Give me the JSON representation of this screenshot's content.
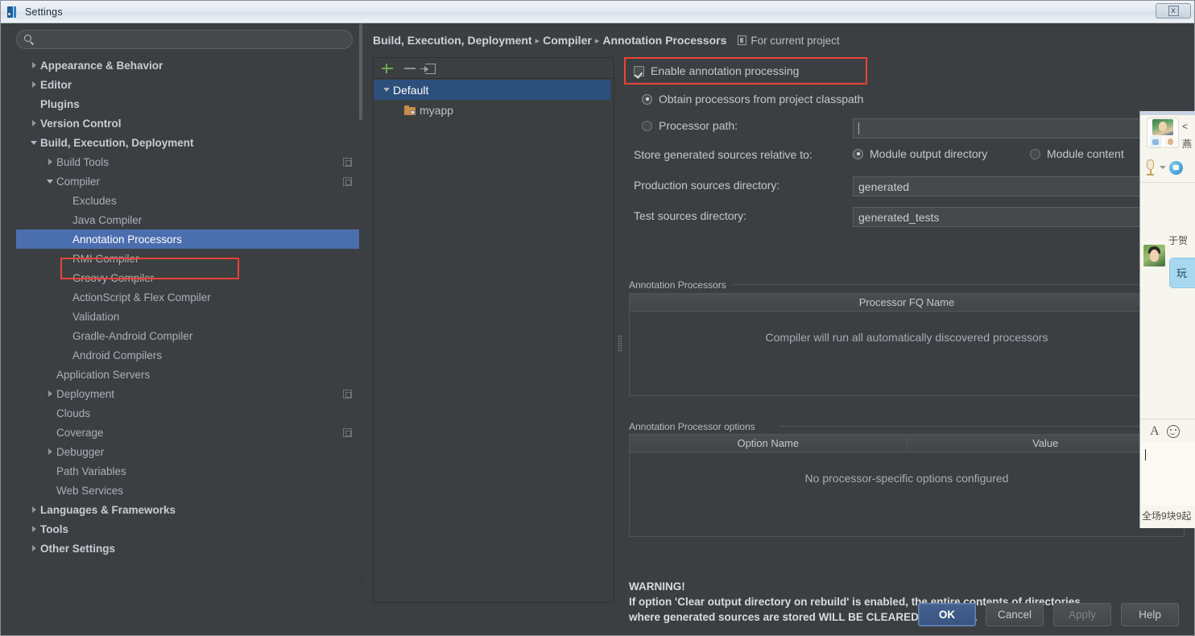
{
  "window": {
    "title": "Settings",
    "app_icon": "intellij-idea-icon",
    "close_label": "x"
  },
  "sidebar": {
    "search": {
      "value": "",
      "placeholder": ""
    },
    "items": [
      {
        "label": "Appearance & Behavior",
        "indent": 0,
        "twisty": "right",
        "bold": true,
        "badge": false,
        "selected": false
      },
      {
        "label": "Editor",
        "indent": 0,
        "twisty": "right",
        "bold": true,
        "badge": false,
        "selected": false
      },
      {
        "label": "Plugins",
        "indent": 0,
        "twisty": "none",
        "bold": true,
        "badge": false,
        "selected": false
      },
      {
        "label": "Version Control",
        "indent": 0,
        "twisty": "right",
        "bold": true,
        "badge": false,
        "selected": false
      },
      {
        "label": "Build, Execution, Deployment",
        "indent": 0,
        "twisty": "down",
        "bold": true,
        "badge": false,
        "selected": false
      },
      {
        "label": "Build Tools",
        "indent": 1,
        "twisty": "right",
        "bold": false,
        "badge": true,
        "selected": false
      },
      {
        "label": "Compiler",
        "indent": 1,
        "twisty": "down",
        "bold": false,
        "badge": true,
        "selected": false
      },
      {
        "label": "Excludes",
        "indent": 2,
        "twisty": "none",
        "bold": false,
        "badge": false,
        "selected": false
      },
      {
        "label": "Java Compiler",
        "indent": 2,
        "twisty": "none",
        "bold": false,
        "badge": false,
        "selected": false
      },
      {
        "label": "Annotation Processors",
        "indent": 2,
        "twisty": "none",
        "bold": false,
        "badge": false,
        "selected": true
      },
      {
        "label": "RMI Compiler",
        "indent": 2,
        "twisty": "none",
        "bold": false,
        "badge": false,
        "selected": false
      },
      {
        "label": "Groovy Compiler",
        "indent": 2,
        "twisty": "none",
        "bold": false,
        "badge": false,
        "selected": false
      },
      {
        "label": "ActionScript & Flex Compiler",
        "indent": 2,
        "twisty": "none",
        "bold": false,
        "badge": false,
        "selected": false
      },
      {
        "label": "Validation",
        "indent": 2,
        "twisty": "none",
        "bold": false,
        "badge": false,
        "selected": false
      },
      {
        "label": "Gradle-Android Compiler",
        "indent": 2,
        "twisty": "none",
        "bold": false,
        "badge": false,
        "selected": false
      },
      {
        "label": "Android Compilers",
        "indent": 2,
        "twisty": "none",
        "bold": false,
        "badge": false,
        "selected": false
      },
      {
        "label": "Application Servers",
        "indent": 1,
        "twisty": "none",
        "bold": false,
        "badge": false,
        "selected": false
      },
      {
        "label": "Deployment",
        "indent": 1,
        "twisty": "right",
        "bold": false,
        "badge": true,
        "selected": false
      },
      {
        "label": "Clouds",
        "indent": 1,
        "twisty": "none",
        "bold": false,
        "badge": false,
        "selected": false
      },
      {
        "label": "Coverage",
        "indent": 1,
        "twisty": "none",
        "bold": false,
        "badge": true,
        "selected": false
      },
      {
        "label": "Debugger",
        "indent": 1,
        "twisty": "right",
        "bold": false,
        "badge": false,
        "selected": false
      },
      {
        "label": "Path Variables",
        "indent": 1,
        "twisty": "none",
        "bold": false,
        "badge": false,
        "selected": false
      },
      {
        "label": "Web Services",
        "indent": 1,
        "twisty": "none",
        "bold": false,
        "badge": false,
        "selected": false
      },
      {
        "label": "Languages & Frameworks",
        "indent": 0,
        "twisty": "right",
        "bold": true,
        "badge": false,
        "selected": false
      },
      {
        "label": "Tools",
        "indent": 0,
        "twisty": "right",
        "bold": true,
        "badge": false,
        "selected": false
      },
      {
        "label": "Other Settings",
        "indent": 0,
        "twisty": "right",
        "bold": true,
        "badge": false,
        "selected": false
      }
    ]
  },
  "breadcrumb": {
    "part1": "Build, Execution, Deployment",
    "sep1": "▸",
    "part2": "Compiler",
    "sep2": "▸",
    "part3": "Annotation Processors",
    "scope": "For current project",
    "scope_icon": "project-scope-icon"
  },
  "profile_panel": {
    "toolbar": {
      "add": "add-icon",
      "remove": "remove-icon",
      "import": "move-to-icon"
    },
    "nodes": [
      {
        "label": "Default",
        "twisty": "down",
        "selected": true,
        "icon": "none"
      },
      {
        "label": "myapp",
        "twisty": "none",
        "selected": false,
        "icon": "module-icon"
      }
    ]
  },
  "form": {
    "enable_annotation_processing": {
      "label": "Enable annotation processing",
      "checked": true
    },
    "obtain_from_classpath": {
      "label": "Obtain processors from project classpath",
      "selected": true
    },
    "processor_path": {
      "label": "Processor path:",
      "selected": false,
      "value": ""
    },
    "store_relative_label": "Store generated sources relative to:",
    "store_options": [
      {
        "label": "Module output directory",
        "selected": true
      },
      {
        "label": "Module content",
        "selected": false
      }
    ],
    "production_sources": {
      "label": "Production sources directory:",
      "value": "generated"
    },
    "test_sources": {
      "label": "Test sources directory:",
      "value": "generated_tests"
    },
    "processors_group": {
      "title": "Annotation Processors",
      "columns": [
        "Processor FQ Name"
      ],
      "empty_text": "Compiler will run all automatically discovered processors",
      "rows": []
    },
    "options_group": {
      "title": "Annotation Processor options",
      "columns": [
        "Option Name",
        "Value"
      ],
      "empty_text": "No processor-specific options configured",
      "rows": []
    },
    "warning": {
      "heading": "WARNING!",
      "line1": "If option 'Clear output directory on rebuild' is enabled, the entire contents of directories",
      "line2": "where generated sources are stored WILL BE CLEARED on rebuild."
    }
  },
  "footer": {
    "ok": "OK",
    "cancel": "Cancel",
    "apply": "Apply",
    "help": "Help"
  },
  "chat_overlay": {
    "name_line1": "<",
    "name_line2": "燕",
    "mic_icon": "microphone-icon",
    "video_icon": "video-call-icon",
    "sender_name": "于贺",
    "bubble_text": "玩",
    "font_icon": "font-icon",
    "emoji_icon": "emoji-icon",
    "input_value": "",
    "footer_text": "全场9块9起"
  },
  "colors": {
    "accent_selection": "#4b6eaf",
    "highlight_border": "#e8433a",
    "panel_bg": "#3c3f41",
    "text": "#c3c8cc",
    "add_green": "#6aa84f",
    "module_orange": "#c88b4a"
  }
}
